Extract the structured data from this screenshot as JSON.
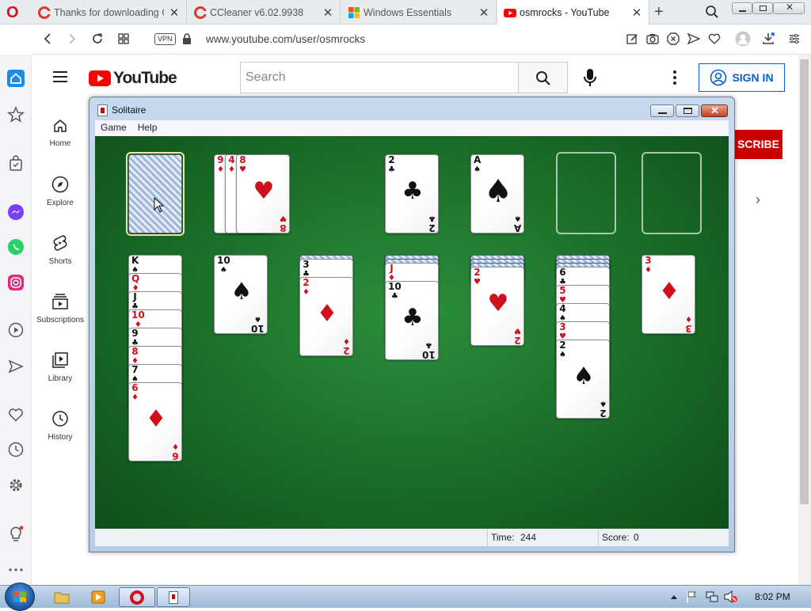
{
  "browser": {
    "tabs": [
      {
        "label": "Thanks for downloading C",
        "icon": "ccleaner-icon",
        "active": false
      },
      {
        "label": "CCleaner v6.02.9938",
        "icon": "ccleaner-icon",
        "active": false
      },
      {
        "label": "Windows Essentials",
        "icon": "windows-icon",
        "active": false
      },
      {
        "label": "osmrocks - YouTube",
        "icon": "youtube-icon",
        "active": true
      }
    ],
    "vpn_label": "VPN",
    "url": "www.youtube.com/user/osmrocks"
  },
  "youtube": {
    "logo_text": "YouTube",
    "search_placeholder": "Search",
    "signin_label": "SIGN IN",
    "subscribe_label": "SCRIBE",
    "nav": [
      {
        "label": "Home",
        "icon": "home-icon"
      },
      {
        "label": "Explore",
        "icon": "compass-icon"
      },
      {
        "label": "Shorts",
        "icon": "shorts-icon"
      },
      {
        "label": "Subscriptions",
        "icon": "subscriptions-icon"
      },
      {
        "label": "Library",
        "icon": "library-icon"
      },
      {
        "label": "History",
        "icon": "history-icon"
      }
    ]
  },
  "solitaire": {
    "title": "Solitaire",
    "menu": [
      "Game",
      "Help"
    ],
    "status": {
      "time_label": "Time:",
      "time": "244",
      "score_label": "Score:",
      "score": "0"
    },
    "waste": [
      "9♦",
      "4♦",
      "8♥"
    ],
    "foundations": [
      "2♣",
      "A♠",
      "",
      ""
    ],
    "tableau": [
      {
        "face_down": 0,
        "face_up": [
          "K♠",
          "Q♦",
          "J♣",
          "10♦",
          "9♣",
          "8♦",
          "7♠",
          "6♦"
        ]
      },
      {
        "face_down": 0,
        "face_up": [
          "10♠"
        ]
      },
      {
        "face_down": 1,
        "face_up": [
          "3♣",
          "2♦"
        ]
      },
      {
        "face_down": 2,
        "face_up": [
          "J♦",
          "10♣"
        ]
      },
      {
        "face_down": 3,
        "face_up": [
          "2♥"
        ]
      },
      {
        "face_down": 3,
        "face_up": [
          "6♣",
          "5♥",
          "4♠",
          "3♥",
          "2♠"
        ]
      },
      {
        "face_down": 0,
        "face_up": [
          "3♦"
        ]
      }
    ]
  },
  "taskbar": {
    "clock": "8:02 PM"
  },
  "colors": {
    "youtube_red": "#ff0000",
    "subscribe_red": "#cc0000",
    "signin_blue": "#065fd4",
    "felt_green": "#1a6c27",
    "red_suit": "#d0101a"
  }
}
